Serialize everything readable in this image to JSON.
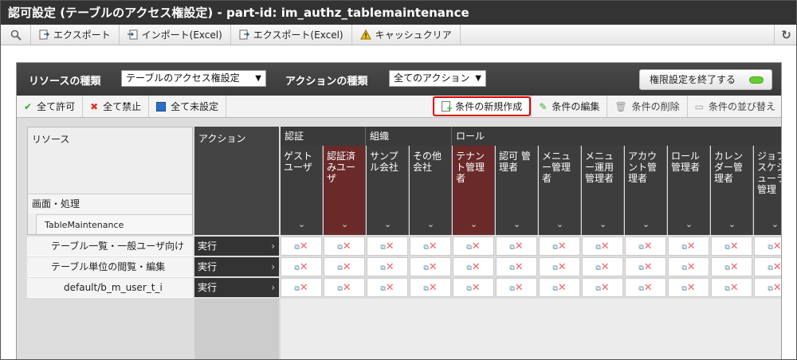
{
  "title": "認可設定 (テーブルのアクセス権設定) - part-id: im_authz_tablemaintenance",
  "toolbar": [
    {
      "label": "",
      "icon": "search-icon"
    },
    {
      "label": "エクスポート",
      "icon": "export-icon"
    },
    {
      "label": "インポート(Excel)",
      "icon": "import-icon"
    },
    {
      "label": "エクスポート(Excel)",
      "icon": "export-excel-icon"
    },
    {
      "label": "キャッシュクリア",
      "icon": "warning-icon"
    }
  ],
  "header": {
    "resource_type_label": "リソースの種類",
    "resource_type_value": "テーブルのアクセス権設定",
    "action_type_label": "アクションの種類",
    "action_type_value": "全てのアクション",
    "end_button": "権限設定を終了する"
  },
  "actions": {
    "allow_all": "全て許可",
    "deny_all": "全て禁止",
    "unset_all": "全て未設定",
    "new_condition": "条件の新規作成",
    "edit_condition": "条件の編集",
    "delete_condition": "条件の削除",
    "sort_condition": "条件の並び替え"
  },
  "grid": {
    "resource_header": "リソース",
    "resource_sub1": "画面・処理",
    "resource_sub2": "TableMaintenance",
    "action_header": "アクション",
    "groups": [
      "認証",
      "組織",
      "ロール"
    ],
    "columns": [
      {
        "label": "ゲストユーザ",
        "selected": false
      },
      {
        "label": "認証済みユーザ",
        "selected": true
      },
      {
        "label": "サンプル会社",
        "selected": false
      },
      {
        "label": "その他会社",
        "selected": false
      },
      {
        "label": "テナント管理者",
        "selected": true
      },
      {
        "label": "認可 管理者",
        "selected": false
      },
      {
        "label": "メニュー管理者",
        "selected": false
      },
      {
        "label": "メニュー運用管理者",
        "selected": false
      },
      {
        "label": "アカウント管理者",
        "selected": false
      },
      {
        "label": "ロール管理者",
        "selected": false
      },
      {
        "label": "カレンダー管理者",
        "selected": false
      },
      {
        "label": "ジョブスケジューラ管理",
        "selected": false
      }
    ],
    "rows": [
      {
        "resource": "テーブル一覧・一般ユーザ向け",
        "action": "実行"
      },
      {
        "resource": "テーブル単位の閲覧・編集",
        "action": "実行"
      },
      {
        "resource": "default/b_m_user_t_i",
        "action": "実行"
      }
    ]
  }
}
